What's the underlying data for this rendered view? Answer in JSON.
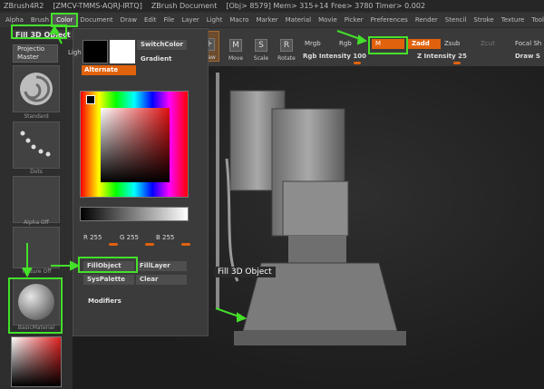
{
  "titlebar": {
    "app": "ZBrush4R2",
    "id": "[ZMCV-TMMS-AQRJ-IRTQ]",
    "doc": "ZBrush Document",
    "stats": "[Obj> 8579] Mem> 315+14 Free> 3780 Timer> 0.002"
  },
  "menubar": {
    "items": [
      "Alpha",
      "Brush",
      "Color",
      "Document",
      "Draw",
      "Edit",
      "File",
      "Layer",
      "Light",
      "Macro",
      "Marker",
      "Material",
      "Movie",
      "Picker",
      "Preferences",
      "Render",
      "Stencil",
      "Stroke",
      "Texture",
      "Tool"
    ],
    "active": "Color"
  },
  "toolbar": {
    "draw_label": "Draw",
    "move_label": "Move",
    "scale_label": "Scale",
    "rotate_label": "Rotate",
    "mrgb_label": "Mrgb",
    "rgb_label": "Rgb",
    "m_label": "M",
    "zadd_label": "Zadd",
    "zsub_label": "Zsub",
    "zcut_label": "Zcut",
    "focal_label": "Focal Sh",
    "rgb_intensity": "Rgb Intensity 100",
    "z_intensity": "Z Intensity 25",
    "draw_size": "Draw S"
  },
  "shelf": {
    "title": "Fill 3D Object",
    "projection_label": "Projectio",
    "projection_sub": "Master",
    "thumb_labels": [
      "Standard",
      "Dots",
      "Alpha Off",
      "Texture Off",
      "BasicMaterial"
    ]
  },
  "palette": {
    "light_label": "Ligh",
    "switch_color": "SwitchColor",
    "gradient": "Gradient",
    "alternate": "Alternate",
    "r_value": "R 255",
    "g_value": "G 255",
    "b_value": "B 255",
    "fill_object": "FillObject",
    "fill_layer": "FillLayer",
    "sys_palette": "SysPalette",
    "clear": "Clear",
    "modifiers": "Modifiers"
  },
  "tooltip": "Fill 3D Object",
  "colors": {
    "accent": "#e1620d",
    "highlight": "#44e02a",
    "background": "#2b2b2b"
  }
}
